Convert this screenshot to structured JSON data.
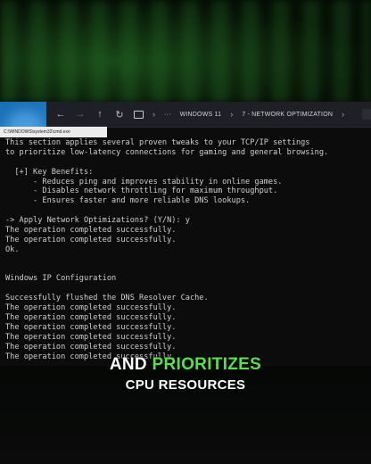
{
  "explorer": {
    "back_icon": "back-arrow-icon",
    "forward_icon": "forward-arrow-icon",
    "up_icon": "up-arrow-icon",
    "refresh_icon": "refresh-icon",
    "breadcrumb": [
      "WINDOWS 11",
      "7 - NETWORK OPTIMIZATION"
    ],
    "more_label": "···"
  },
  "cmd": {
    "title": "C:\\WINDOWS\\system32\\cmd.exe",
    "lines": [
      "This section applies several proven tweaks to your TCP/IP settings",
      "to prioritize low-latency connections for gaming and general browsing.",
      "",
      "  [+] Key Benefits:",
      "      - Reduces ping and improves stability in online games.",
      "      - Disables network throttling for maximum throughput.",
      "      - Ensures faster and more reliable DNS lookups.",
      "",
      "-> Apply Network Optimizations? (Y/N): y",
      "The operation completed successfully.",
      "The operation completed successfully.",
      "Ok.",
      "",
      "",
      "Windows IP Configuration",
      "",
      "Successfully flushed the DNS Resolver Cache.",
      "The operation completed successfully.",
      "The operation completed successfully.",
      "The operation completed successfully.",
      "The operation completed successfully.",
      "The operation completed successfully.",
      "The operation completed successfully."
    ]
  },
  "caption": {
    "word1": "AND",
    "word2_highlight": "PRIORITIZES",
    "line2": "CPU RESOURCES",
    "highlight_color": "#58e04a"
  }
}
